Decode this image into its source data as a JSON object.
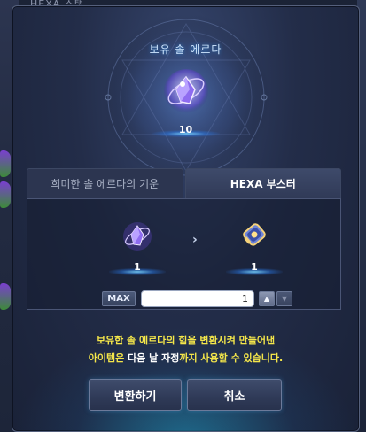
{
  "background": {
    "top_text": "HEXA 스탯"
  },
  "dialog": {
    "title": "보유 솔 에르다",
    "held_count": "10",
    "held_item_icon": "sol-erda-icon"
  },
  "tabs": [
    {
      "label": "희미한 솔 에르다의 기운",
      "active": false
    },
    {
      "label": "HEXA 부스터",
      "active": true
    }
  ],
  "conversion": {
    "source_icon": "sol-erda-icon",
    "source_count": "1",
    "arrow": "›",
    "target_icon": "hexa-booster-icon",
    "target_count": "1",
    "max_label": "MAX",
    "quantity_value": "1",
    "step_up": "▲",
    "step_down": "▼"
  },
  "notice": {
    "line1": "보유한 솔 에르다의 힘을 변환시켜 만들어낸",
    "line2_a": "아이템은",
    "line2_b": " 다음 날 자정",
    "line2_c": "까지 사용할 수 있습니다."
  },
  "buttons": {
    "convert": "변환하기",
    "cancel": "취소"
  },
  "colors": {
    "notice_yellow": "#f4e64a",
    "accent_cyan": "#4fb8ff",
    "window_bg": "#232d49"
  }
}
